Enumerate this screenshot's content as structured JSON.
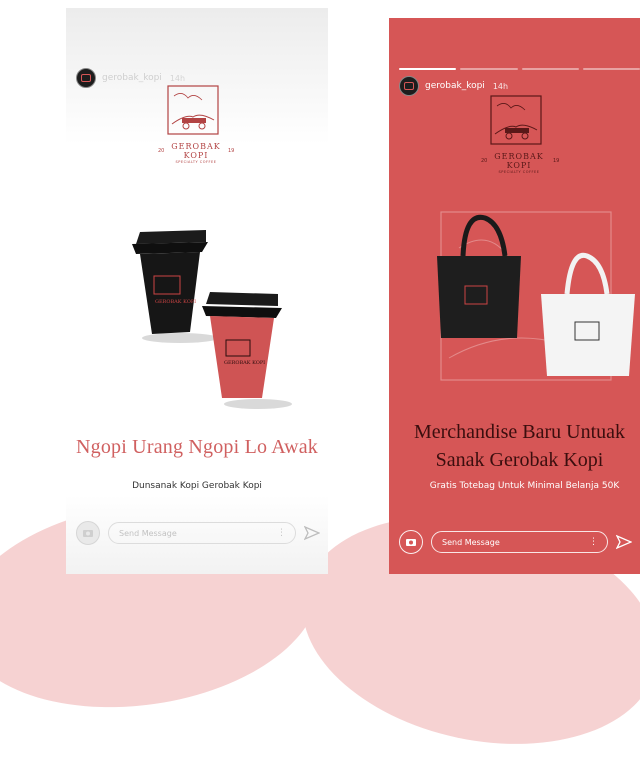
{
  "stories": [
    {
      "username": "gerobak_kopi",
      "age": "14h",
      "brand": "GEROBAK KOPI",
      "brand_sub": "SPECIALTY COFFEE",
      "year_left": "20",
      "year_right": "19",
      "headline": "Ngopi Urang Ngopi Lo Awak",
      "subtext": "Dunsanak Kopi Gerobak Kopi",
      "message_placeholder": "Send Message",
      "icons": [
        "camera-icon",
        "more-dots-icon",
        "send-icon"
      ],
      "colors": {
        "accent": "#d06060"
      }
    },
    {
      "username": "gerobak_kopi",
      "age": "14h",
      "brand": "GEROBAK KOPI",
      "brand_sub": "SPECIALTY COFFEE",
      "year_left": "20",
      "year_right": "19",
      "headline": "Merchandise Baru Untuak Sanak Gerobak Kopi",
      "subtext": "Gratis Totebag Untuk Minimal Belanja 50K",
      "message_placeholder": "Send Message",
      "icons": [
        "camera-icon",
        "more-dots-icon",
        "send-icon"
      ],
      "colors": {
        "background": "#d65656",
        "text_dark": "#3b0e0e"
      }
    }
  ]
}
